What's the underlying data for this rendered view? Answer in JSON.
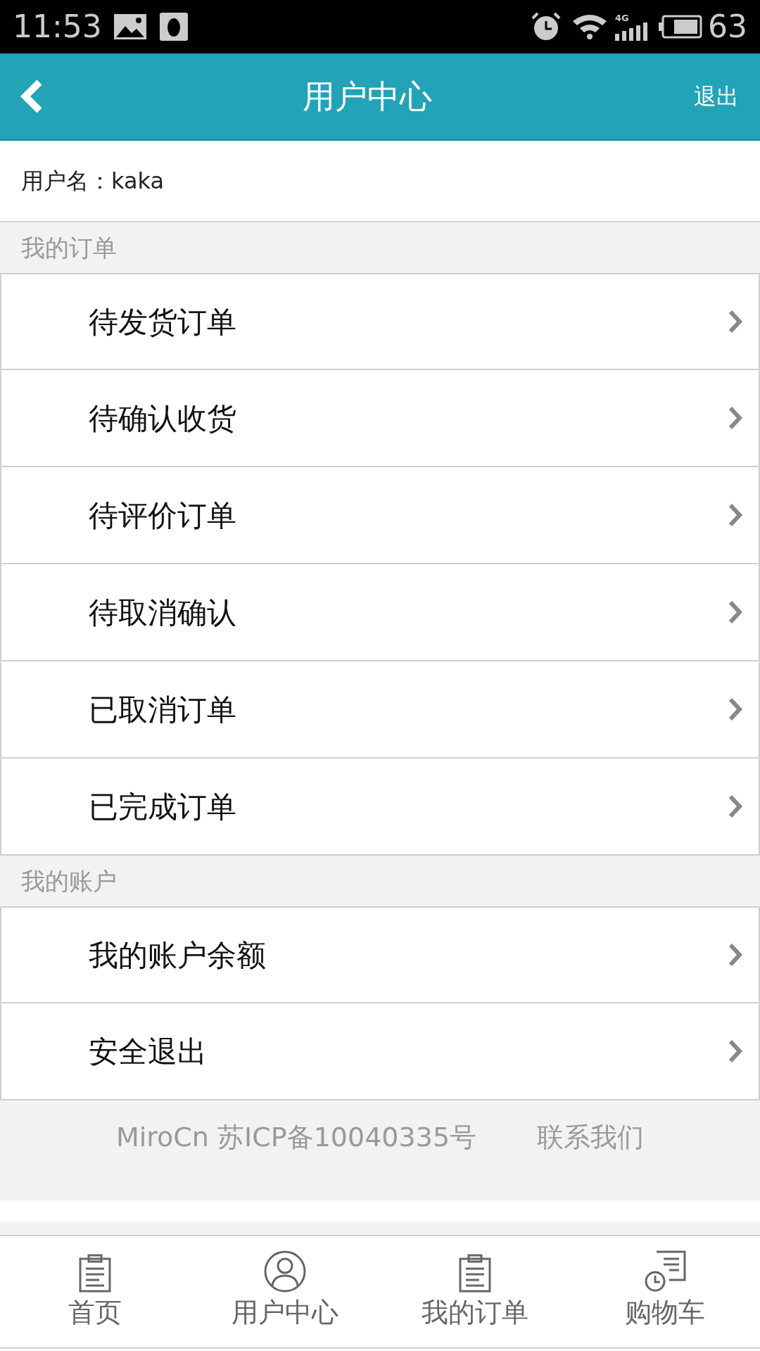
{
  "status_bar": {
    "time": "11:53",
    "network": "4G",
    "battery": "63"
  },
  "header": {
    "title": "用户中心",
    "action": "退出"
  },
  "user": {
    "label": "用户名：kaka"
  },
  "sections": [
    {
      "title": "我的订单",
      "items": [
        "待发货订单",
        "待确认收货",
        "待评价订单",
        "待取消确认",
        "已取消订单",
        "已完成订单"
      ]
    },
    {
      "title": "我的账户",
      "items": [
        "我的账户余额",
        "安全退出"
      ]
    }
  ],
  "footer": {
    "copyright": "MiroCn 苏ICP备10040335号",
    "contact": "联系我们"
  },
  "bottom_nav": [
    {
      "label": "首页",
      "kind": "clipboard"
    },
    {
      "label": "用户中心",
      "kind": "user"
    },
    {
      "label": "我的订单",
      "kind": "clipboard"
    },
    {
      "label": "购物车",
      "kind": "history"
    }
  ]
}
